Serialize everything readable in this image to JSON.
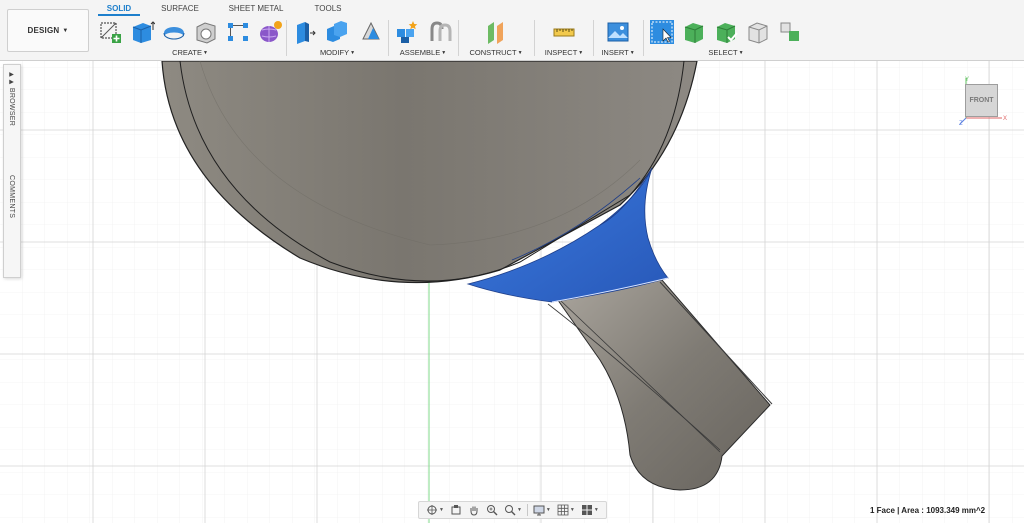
{
  "app": {
    "workspace_button": "DESIGN",
    "tabs": [
      {
        "label": "SOLID",
        "active": true
      },
      {
        "label": "SURFACE",
        "active": false
      },
      {
        "label": "SHEET METAL",
        "active": false
      },
      {
        "label": "TOOLS",
        "active": false
      }
    ]
  },
  "toolbar": {
    "groups": [
      {
        "label": "CREATE",
        "icons": [
          "create-sketch-icon",
          "extrude-icon",
          "revolve-icon",
          "shell-icon",
          "rectangle-pattern-icon",
          "form-icon"
        ]
      },
      {
        "label": "MODIFY",
        "icons": [
          "press-pull-icon",
          "combine-icon",
          "draft-icon"
        ]
      },
      {
        "label": "ASSEMBLE",
        "icons": [
          "new-component-icon",
          "joint-icon"
        ]
      },
      {
        "label": "CONSTRUCT",
        "icons": [
          "offset-plane-icon"
        ]
      },
      {
        "label": "INSPECT",
        "icons": [
          "measure-icon"
        ]
      },
      {
        "label": "INSERT",
        "icons": [
          "insert-image-icon"
        ]
      },
      {
        "label": "SELECT",
        "icons": [
          "select-icon",
          "body-select-icon",
          "component-select-icon",
          "face-select-icon",
          "edge-select-icon"
        ]
      }
    ],
    "accent_color": "#1d7fcc"
  },
  "side_panel": {
    "browser_label": "BROWSER",
    "comments_label": "COMMENTS"
  },
  "viewcube": {
    "face_label": "FRONT",
    "axis_x": "X",
    "axis_y": "Y",
    "axis_z": "Z"
  },
  "nav_bar": {
    "icons": [
      "orbit-icon",
      "look-at-icon",
      "pan-icon",
      "zoom-window-icon",
      "zoom-icon",
      "display-settings-icon",
      "grid-icon",
      "viewports-icon"
    ]
  },
  "status": {
    "selection": "1 Face | Area : 1093.349 mm^2"
  },
  "colors": {
    "selected_face": "#2f6fd8",
    "body": "#8c8880",
    "grid": "#d9d9d9",
    "axis_green": "#6fd27a"
  }
}
